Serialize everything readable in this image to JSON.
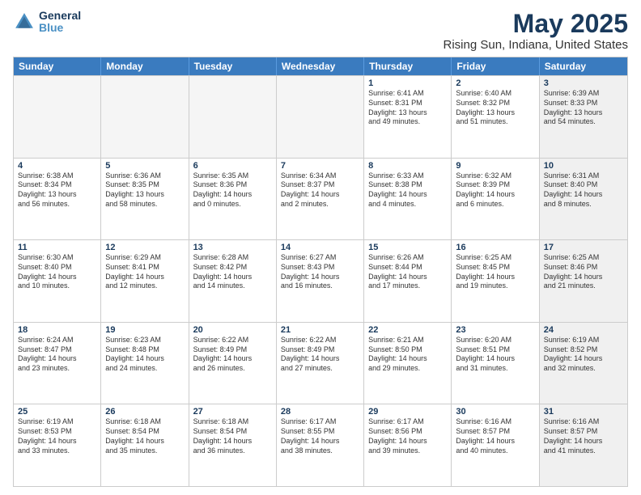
{
  "logo": {
    "general": "General",
    "blue": "Blue"
  },
  "title": "May 2025",
  "subtitle": "Rising Sun, Indiana, United States",
  "days": [
    "Sunday",
    "Monday",
    "Tuesday",
    "Wednesday",
    "Thursday",
    "Friday",
    "Saturday"
  ],
  "rows": [
    [
      {
        "day": "",
        "lines": [],
        "empty": true
      },
      {
        "day": "",
        "lines": [],
        "empty": true
      },
      {
        "day": "",
        "lines": [],
        "empty": true
      },
      {
        "day": "",
        "lines": [],
        "empty": true
      },
      {
        "day": "1",
        "lines": [
          "Sunrise: 6:41 AM",
          "Sunset: 8:31 PM",
          "Daylight: 13 hours",
          "and 49 minutes."
        ]
      },
      {
        "day": "2",
        "lines": [
          "Sunrise: 6:40 AM",
          "Sunset: 8:32 PM",
          "Daylight: 13 hours",
          "and 51 minutes."
        ]
      },
      {
        "day": "3",
        "lines": [
          "Sunrise: 6:39 AM",
          "Sunset: 8:33 PM",
          "Daylight: 13 hours",
          "and 54 minutes."
        ],
        "shaded": true
      }
    ],
    [
      {
        "day": "4",
        "lines": [
          "Sunrise: 6:38 AM",
          "Sunset: 8:34 PM",
          "Daylight: 13 hours",
          "and 56 minutes."
        ]
      },
      {
        "day": "5",
        "lines": [
          "Sunrise: 6:36 AM",
          "Sunset: 8:35 PM",
          "Daylight: 13 hours",
          "and 58 minutes."
        ]
      },
      {
        "day": "6",
        "lines": [
          "Sunrise: 6:35 AM",
          "Sunset: 8:36 PM",
          "Daylight: 14 hours",
          "and 0 minutes."
        ]
      },
      {
        "day": "7",
        "lines": [
          "Sunrise: 6:34 AM",
          "Sunset: 8:37 PM",
          "Daylight: 14 hours",
          "and 2 minutes."
        ]
      },
      {
        "day": "8",
        "lines": [
          "Sunrise: 6:33 AM",
          "Sunset: 8:38 PM",
          "Daylight: 14 hours",
          "and 4 minutes."
        ]
      },
      {
        "day": "9",
        "lines": [
          "Sunrise: 6:32 AM",
          "Sunset: 8:39 PM",
          "Daylight: 14 hours",
          "and 6 minutes."
        ]
      },
      {
        "day": "10",
        "lines": [
          "Sunrise: 6:31 AM",
          "Sunset: 8:40 PM",
          "Daylight: 14 hours",
          "and 8 minutes."
        ],
        "shaded": true
      }
    ],
    [
      {
        "day": "11",
        "lines": [
          "Sunrise: 6:30 AM",
          "Sunset: 8:40 PM",
          "Daylight: 14 hours",
          "and 10 minutes."
        ]
      },
      {
        "day": "12",
        "lines": [
          "Sunrise: 6:29 AM",
          "Sunset: 8:41 PM",
          "Daylight: 14 hours",
          "and 12 minutes."
        ]
      },
      {
        "day": "13",
        "lines": [
          "Sunrise: 6:28 AM",
          "Sunset: 8:42 PM",
          "Daylight: 14 hours",
          "and 14 minutes."
        ]
      },
      {
        "day": "14",
        "lines": [
          "Sunrise: 6:27 AM",
          "Sunset: 8:43 PM",
          "Daylight: 14 hours",
          "and 16 minutes."
        ]
      },
      {
        "day": "15",
        "lines": [
          "Sunrise: 6:26 AM",
          "Sunset: 8:44 PM",
          "Daylight: 14 hours",
          "and 17 minutes."
        ]
      },
      {
        "day": "16",
        "lines": [
          "Sunrise: 6:25 AM",
          "Sunset: 8:45 PM",
          "Daylight: 14 hours",
          "and 19 minutes."
        ]
      },
      {
        "day": "17",
        "lines": [
          "Sunrise: 6:25 AM",
          "Sunset: 8:46 PM",
          "Daylight: 14 hours",
          "and 21 minutes."
        ],
        "shaded": true
      }
    ],
    [
      {
        "day": "18",
        "lines": [
          "Sunrise: 6:24 AM",
          "Sunset: 8:47 PM",
          "Daylight: 14 hours",
          "and 23 minutes."
        ]
      },
      {
        "day": "19",
        "lines": [
          "Sunrise: 6:23 AM",
          "Sunset: 8:48 PM",
          "Daylight: 14 hours",
          "and 24 minutes."
        ]
      },
      {
        "day": "20",
        "lines": [
          "Sunrise: 6:22 AM",
          "Sunset: 8:49 PM",
          "Daylight: 14 hours",
          "and 26 minutes."
        ]
      },
      {
        "day": "21",
        "lines": [
          "Sunrise: 6:22 AM",
          "Sunset: 8:49 PM",
          "Daylight: 14 hours",
          "and 27 minutes."
        ]
      },
      {
        "day": "22",
        "lines": [
          "Sunrise: 6:21 AM",
          "Sunset: 8:50 PM",
          "Daylight: 14 hours",
          "and 29 minutes."
        ]
      },
      {
        "day": "23",
        "lines": [
          "Sunrise: 6:20 AM",
          "Sunset: 8:51 PM",
          "Daylight: 14 hours",
          "and 31 minutes."
        ]
      },
      {
        "day": "24",
        "lines": [
          "Sunrise: 6:19 AM",
          "Sunset: 8:52 PM",
          "Daylight: 14 hours",
          "and 32 minutes."
        ],
        "shaded": true
      }
    ],
    [
      {
        "day": "25",
        "lines": [
          "Sunrise: 6:19 AM",
          "Sunset: 8:53 PM",
          "Daylight: 14 hours",
          "and 33 minutes."
        ]
      },
      {
        "day": "26",
        "lines": [
          "Sunrise: 6:18 AM",
          "Sunset: 8:54 PM",
          "Daylight: 14 hours",
          "and 35 minutes."
        ]
      },
      {
        "day": "27",
        "lines": [
          "Sunrise: 6:18 AM",
          "Sunset: 8:54 PM",
          "Daylight: 14 hours",
          "and 36 minutes."
        ]
      },
      {
        "day": "28",
        "lines": [
          "Sunrise: 6:17 AM",
          "Sunset: 8:55 PM",
          "Daylight: 14 hours",
          "and 38 minutes."
        ]
      },
      {
        "day": "29",
        "lines": [
          "Sunrise: 6:17 AM",
          "Sunset: 8:56 PM",
          "Daylight: 14 hours",
          "and 39 minutes."
        ]
      },
      {
        "day": "30",
        "lines": [
          "Sunrise: 6:16 AM",
          "Sunset: 8:57 PM",
          "Daylight: 14 hours",
          "and 40 minutes."
        ]
      },
      {
        "day": "31",
        "lines": [
          "Sunrise: 6:16 AM",
          "Sunset: 8:57 PM",
          "Daylight: 14 hours",
          "and 41 minutes."
        ],
        "shaded": true
      }
    ]
  ]
}
